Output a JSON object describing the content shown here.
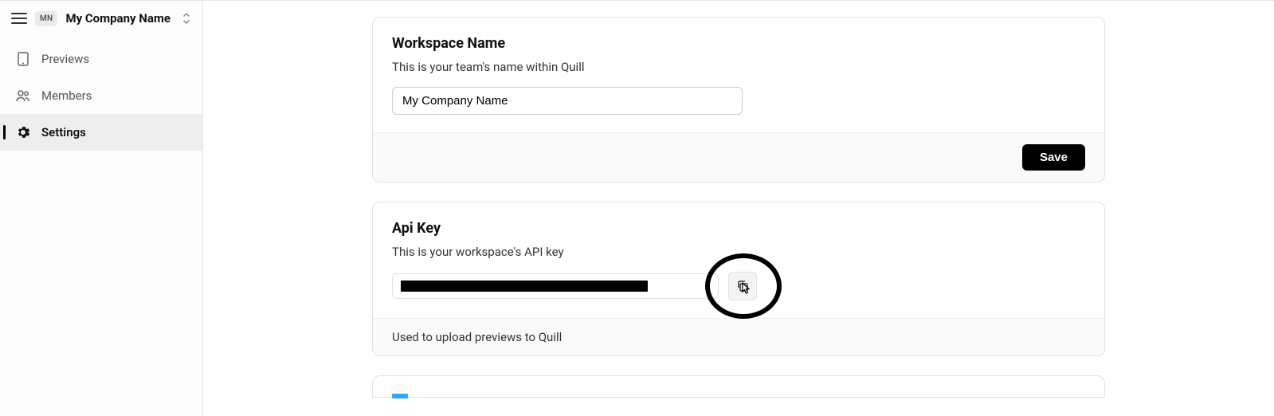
{
  "header": {
    "org_initials": "MN",
    "org_name": "My Company Name"
  },
  "sidebar": {
    "items": [
      {
        "label": "Previews"
      },
      {
        "label": "Members"
      },
      {
        "label": "Settings"
      }
    ]
  },
  "workspace_card": {
    "title": "Workspace Name",
    "description": "This is your team's name within Quill",
    "value": "My Company Name",
    "save_label": "Save"
  },
  "api_card": {
    "title": "Api Key",
    "description": "This is your workspace's API key",
    "masked_value": "••••••••••••••••••••••••••••••••",
    "footer_text": "Used to upload previews to Quill"
  }
}
